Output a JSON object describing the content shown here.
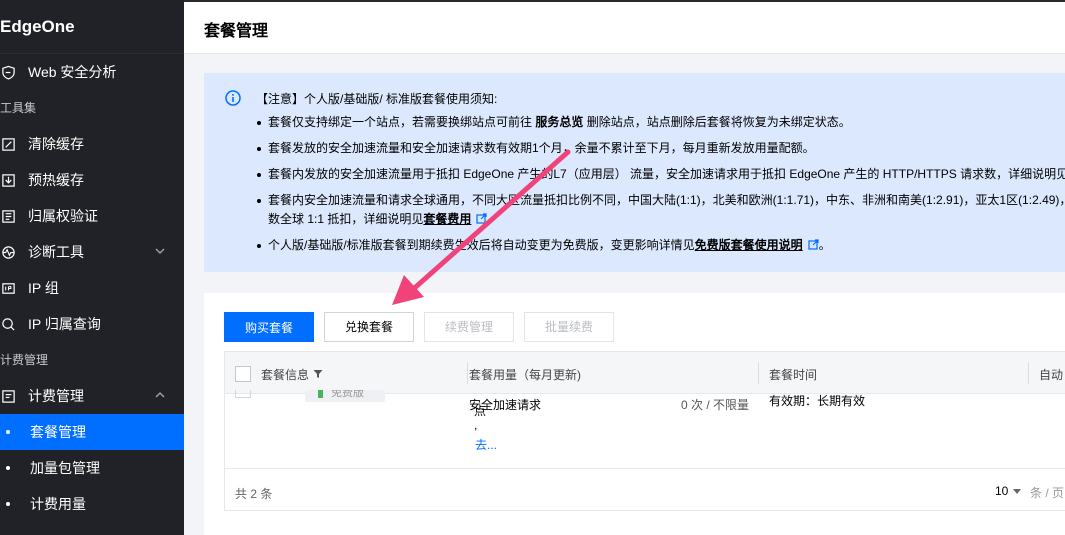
{
  "sidebar": {
    "brand": "EdgeOne",
    "items": [
      {
        "label": "Web 安全分析"
      },
      {
        "group": "工具集"
      },
      {
        "label": "清除缓存"
      },
      {
        "label": "预热缓存"
      },
      {
        "label": "归属权验证"
      },
      {
        "label": "诊断工具"
      },
      {
        "label": "IP 组"
      },
      {
        "label": "IP 归属查询"
      },
      {
        "group": "计费管理"
      },
      {
        "label": "计费管理"
      },
      {
        "label": "套餐管理"
      },
      {
        "label": "加量包管理"
      },
      {
        "label": "计费用量"
      }
    ]
  },
  "header": {
    "title": "套餐管理"
  },
  "notice": {
    "head": "【注意】个人版/基础版/ 标准版套餐使用须知:",
    "l1_pre": "套餐仅支持绑定一个站点，若需要换绑站点可前往 ",
    "l1_bold": "服务总览",
    "l1_post": " 删除站点，站点删除后套餐将恢复为未绑定状态。",
    "l2": "套餐发放的安全加速流量和安全加速请求数有效期1个月，余量不累计至下月，每月重新发放用量配额。",
    "l3": "套餐内发放的安全加速流量用于抵扣 EdgeOne 产生的L7（应用层） 流量，安全加速请求用于抵扣 EdgeOne 产生的 HTTP/HTTPS 请求数，详细说明见",
    "l4a": "套餐内安全加速流量和请求全球通用，不同大区流量抵扣比例不同，中国大陆(1:1)，北美和欧洲(1:1.71)，中东、非洲和南美(1:2.91)，亚太1区(1:2.49)，",
    "l4b_pre": "数全球 1:1 抵扣，详细说明见",
    "l4b_link": "套餐费用",
    "l5_pre": "个人版/基础版/标准版套餐到期续费生效后将自动变更为免费版，变更影响详情见",
    "l5_link": "免费版套餐使用说明",
    "l5_post": "。"
  },
  "toolbar": {
    "buy": "购买套餐",
    "exchange": "兑换套餐",
    "renew_manage": "续费管理",
    "batch_renew": "批量续费"
  },
  "table": {
    "columns": [
      "套餐信息",
      "套餐用量（每月更新)",
      "套餐时间",
      "自动"
    ],
    "row": {
      "plan_badge": "免费版",
      "usage_name": "安全加速请求",
      "usage_value": "0 次 / 不限量",
      "glyph1": "点",
      "glyph2": ",",
      "more": "去...",
      "time": "有效期：长期有效"
    },
    "total": "共 2 条",
    "page_size": "10",
    "per_page": "条 / 页"
  },
  "colors": {
    "accent": "#006eff",
    "sidebar": "#212227",
    "notice": "#dbe8fd",
    "arrow": "#f0437a"
  }
}
